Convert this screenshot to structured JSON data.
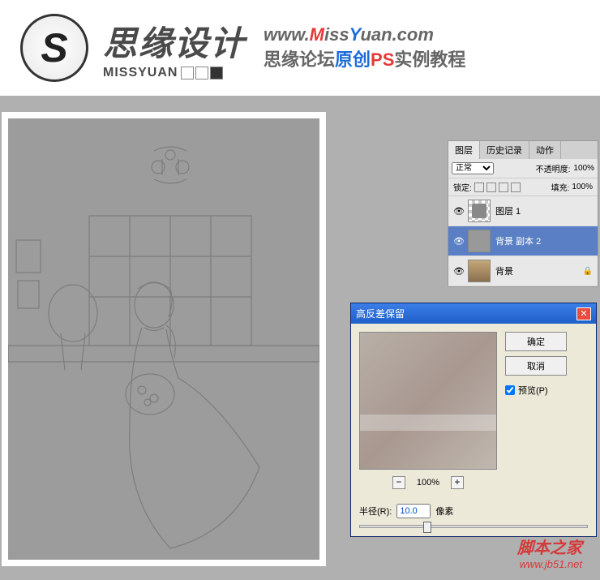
{
  "banner": {
    "logo_letter": "S",
    "brand_cn": "思缘设计",
    "brand_en": "MISSYUAN",
    "url_prefix": "www.",
    "url_m": "M",
    "url_iss": "iss",
    "url_y": "Y",
    "url_uan": "uan.com",
    "sub_a": "思缘论坛",
    "sub_b": "原创",
    "sub_c": "PS",
    "sub_d": "实例教程"
  },
  "layers": {
    "tabs": [
      "图层",
      "历史记录",
      "动作"
    ],
    "blend_mode": "正常",
    "opacity_label": "不透明度:",
    "opacity_value": "100%",
    "lock_label": "锁定:",
    "fill_label": "填充:",
    "fill_value": "100%",
    "items": [
      {
        "name": "图层 1",
        "selected": false,
        "type": "trans"
      },
      {
        "name": "背景 副本 2",
        "selected": true,
        "type": "gray"
      },
      {
        "name": "背景",
        "selected": false,
        "type": "photo",
        "locked": true
      }
    ]
  },
  "dialog": {
    "title": "高反差保留",
    "ok": "确定",
    "cancel": "取消",
    "preview_label": "预览(P)",
    "zoom": "100%",
    "radius_label": "半径(R):",
    "radius_value": "10.0",
    "radius_unit": "像素"
  },
  "watermark": {
    "cn": "脚本之家",
    "url": "www.jb51.net"
  }
}
